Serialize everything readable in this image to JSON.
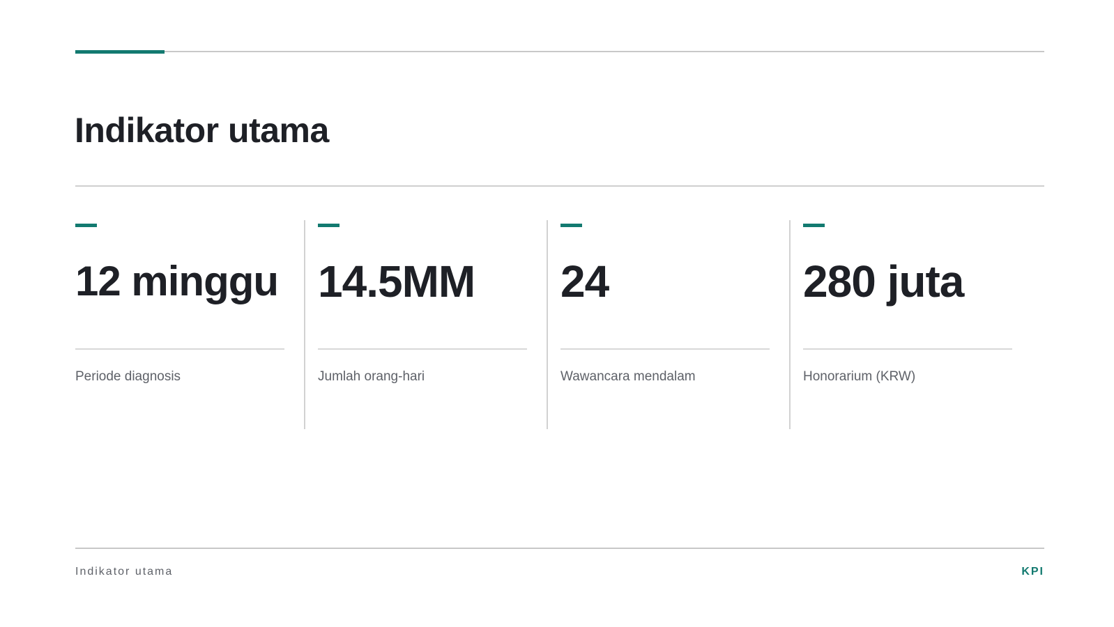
{
  "header": {
    "title": "Indikator utama"
  },
  "kpis": [
    {
      "value": "12 minggu",
      "label": "Periode diagnosis"
    },
    {
      "value": "14.5MM",
      "label": "Jumlah orang-hari"
    },
    {
      "value": "24",
      "label": "Wawancara mendalam"
    },
    {
      "value": "280 juta",
      "label": "Honorarium (KRW)"
    }
  ],
  "footer": {
    "left": "Indikator utama",
    "right": "KPI"
  },
  "colors": {
    "accent": "#137a70",
    "text": "#1e2026",
    "muted": "#5e6168",
    "rule": "#c8c8c8"
  }
}
